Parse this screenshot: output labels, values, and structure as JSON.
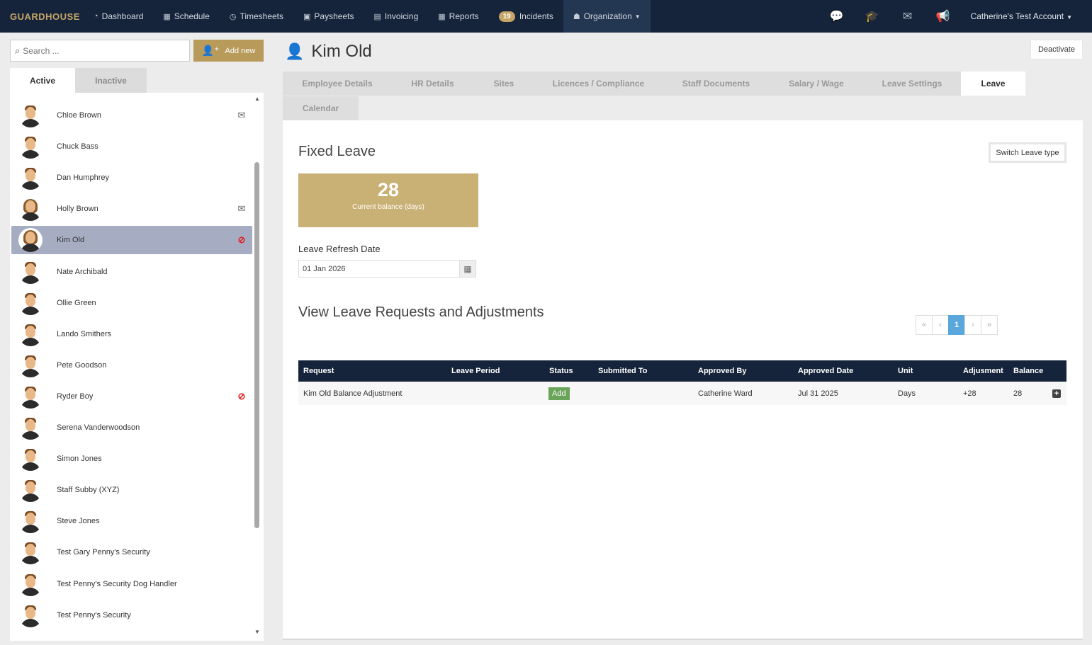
{
  "nav": {
    "brand": "GUARDHOUSE",
    "items": [
      {
        "label": "Dashboard",
        "icon": "dashboard-icon"
      },
      {
        "label": "Schedule",
        "icon": "calendar-icon"
      },
      {
        "label": "Timesheets",
        "icon": "clock-icon"
      },
      {
        "label": "Paysheets",
        "icon": "money-icon"
      },
      {
        "label": "Invoicing",
        "icon": "invoice-icon"
      },
      {
        "label": "Reports",
        "icon": "table-icon"
      }
    ],
    "incidents_count": "19",
    "incidents_label": "Incidents",
    "organization_label": "Organization",
    "account_label": "Catherine's Test Account",
    "right_icons": [
      "chat-icon",
      "graduation-cap-icon",
      "envelope-icon",
      "megaphone-icon"
    ]
  },
  "left": {
    "search_placeholder": "Search ...",
    "add_new_label": "Add new",
    "tab_active": "Active",
    "tab_inactive": "Inactive",
    "employees": [
      {
        "name": "Chloe Brown",
        "avatar": "male",
        "flag": "mail"
      },
      {
        "name": "Chuck Bass",
        "avatar": "male",
        "flag": ""
      },
      {
        "name": "Dan Humphrey",
        "avatar": "male",
        "flag": ""
      },
      {
        "name": "Holly Brown",
        "avatar": "female",
        "flag": "mail"
      },
      {
        "name": "Kim Old",
        "avatar": "female",
        "flag": "blocked",
        "selected": true
      },
      {
        "name": "Nate Archibald",
        "avatar": "male",
        "flag": ""
      },
      {
        "name": "Ollie Green",
        "avatar": "male",
        "flag": ""
      },
      {
        "name": "Lando Smithers",
        "avatar": "male",
        "flag": ""
      },
      {
        "name": "Pete Goodson",
        "avatar": "male",
        "flag": ""
      },
      {
        "name": "Ryder Boy",
        "avatar": "male",
        "flag": "blocked"
      },
      {
        "name": "Serena Vanderwoodson",
        "avatar": "male",
        "flag": ""
      },
      {
        "name": "Simon Jones",
        "avatar": "male",
        "flag": ""
      },
      {
        "name": "Staff Subby (XYZ)",
        "avatar": "male",
        "flag": ""
      },
      {
        "name": "Steve Jones",
        "avatar": "male",
        "flag": ""
      },
      {
        "name": "Test Gary Penny's Security",
        "avatar": "male",
        "flag": ""
      },
      {
        "name": "Test Penny's Security Dog Handler",
        "avatar": "male",
        "flag": ""
      },
      {
        "name": "Test Penny's Security",
        "avatar": "male",
        "flag": ""
      }
    ]
  },
  "main": {
    "employee_name": "Kim Old",
    "deactivate_label": "Deactivate",
    "tabs": [
      {
        "label": "Employee Details"
      },
      {
        "label": "HR Details"
      },
      {
        "label": "Sites"
      },
      {
        "label": "Licences / Compliance"
      },
      {
        "label": "Staff Documents"
      },
      {
        "label": "Salary / Wage"
      },
      {
        "label": "Leave Settings"
      },
      {
        "label": "Leave",
        "active": true
      },
      {
        "label": "Calendar"
      }
    ],
    "fixed_leave_title": "Fixed Leave",
    "switch_leave_label": "Switch Leave type",
    "balance_value": "28",
    "balance_label": "Current balance (days)",
    "refresh_label": "Leave Refresh Date",
    "refresh_date": "01 Jan 2026",
    "requests_title": "View Leave Requests and Adjustments",
    "pager": [
      "«",
      "‹",
      "1",
      "›",
      "»"
    ],
    "pager_current": "1",
    "table": {
      "headers": [
        "Request",
        "Leave Period",
        "Status",
        "Submitted To",
        "Approved By",
        "Approved Date",
        "Unit",
        "Adjusment",
        "Balance"
      ],
      "rows": [
        {
          "request": "Kim Old Balance Adjustment",
          "leave_period": "",
          "status": "Add",
          "submitted_to": "",
          "approved_by": "Catherine Ward",
          "approved_date": "Jul 31 2025",
          "unit": "Days",
          "adjustment": "+28",
          "balance": "28"
        }
      ]
    }
  }
}
